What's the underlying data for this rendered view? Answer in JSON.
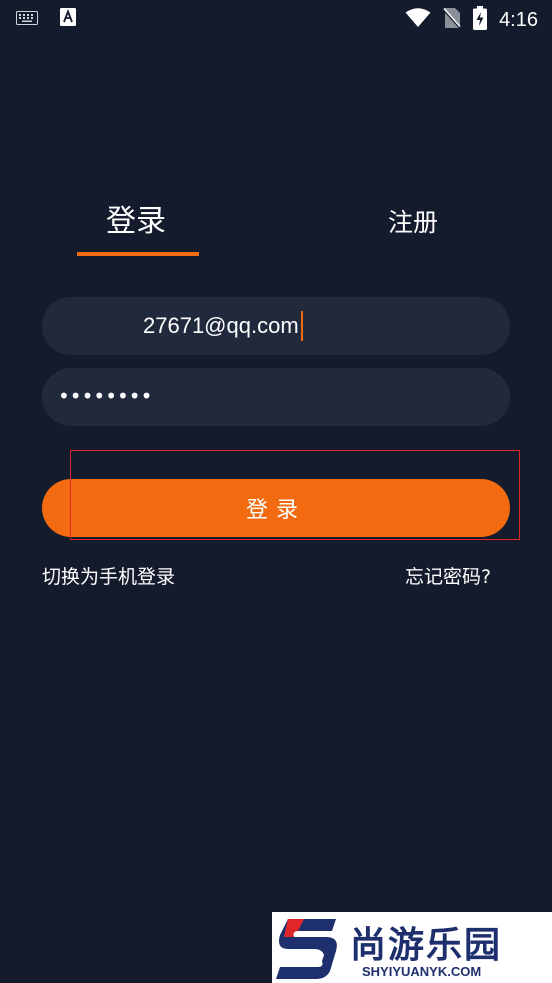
{
  "status_bar": {
    "time": "4:16",
    "icons": [
      "keyboard-icon",
      "text-a-icon",
      "wifi-icon",
      "no-sim-icon",
      "battery-charging-icon"
    ]
  },
  "tabs": {
    "login": "登录",
    "register": "注册",
    "active": "login"
  },
  "form": {
    "email_value": "27671@qq.com",
    "password_masked": "••••••••"
  },
  "login_button": {
    "label": "登录"
  },
  "links": {
    "switch_phone_login": "切换为手机登录",
    "forgot_password": "忘记密码?"
  },
  "watermark": {
    "logo_text": "尚游乐园",
    "url": "SHYIYUANYK.COM"
  },
  "colors": {
    "background": "#141b2d",
    "input_bg": "#212a3c",
    "accent": "#f26b10",
    "highlight": "#e0252b"
  }
}
